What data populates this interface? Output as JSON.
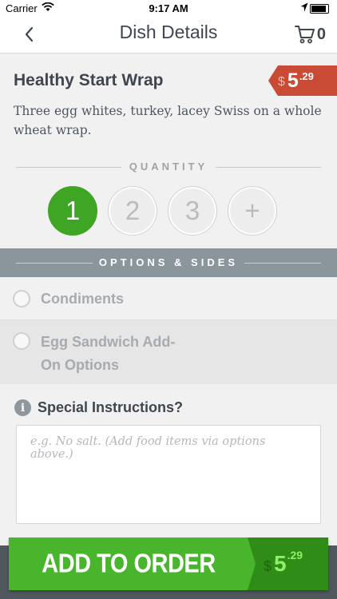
{
  "status_bar": {
    "carrier": "Carrier",
    "time": "9:17 AM"
  },
  "nav": {
    "title": "Dish Details",
    "cart_count": "0"
  },
  "dish": {
    "name": "Healthy Start Wrap",
    "price_currency": "$",
    "price_whole": "5",
    "price_cents": ".29",
    "description": "Three egg whites, turkey, lacey Swiss on a whole wheat wrap."
  },
  "quantity": {
    "label": "QUANTITY",
    "options": [
      "1",
      "2",
      "3",
      "+"
    ],
    "selected": "1"
  },
  "options": {
    "label": "OPTIONS & SIDES",
    "items": [
      {
        "label": "Condiments"
      },
      {
        "label": "Egg Sandwich Add-On Options"
      }
    ]
  },
  "special": {
    "label": "Special Instructions?",
    "placeholder": "e.g. No salt. (Add food items via options above.)"
  },
  "cta": {
    "label": "ADD TO ORDER",
    "price_currency": "$",
    "price_whole": "5",
    "price_cents": ".29"
  },
  "colors": {
    "accent_green": "#49b52c",
    "price_red": "#c94a35",
    "band_gray": "#8b959c"
  },
  "icons": [
    "wifi-icon",
    "location-icon",
    "battery-icon",
    "back-chevron-icon",
    "cart-icon",
    "info-icon"
  ]
}
